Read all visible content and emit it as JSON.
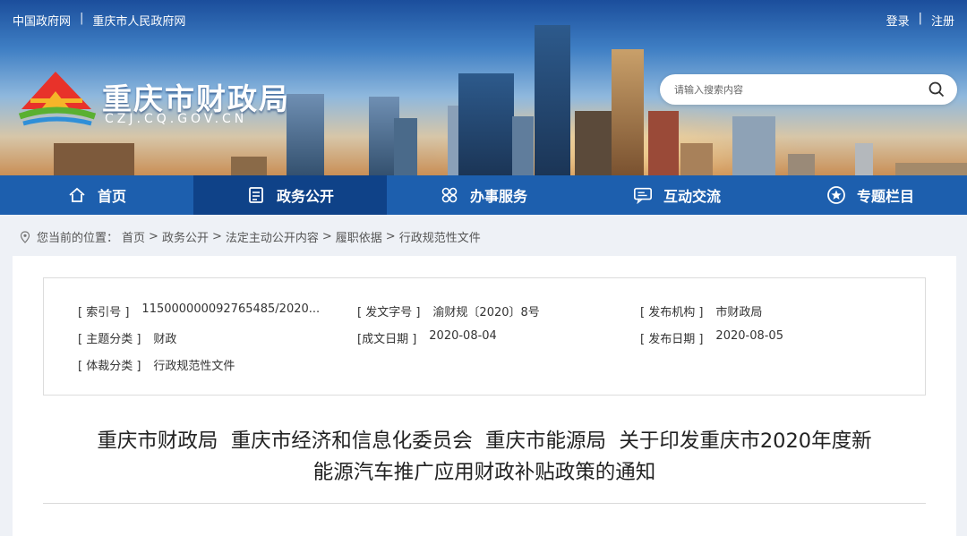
{
  "header": {
    "top_links": [
      "中国政府网",
      "重庆市人民政府网"
    ],
    "top_separator": "|",
    "auth_links": [
      "登录",
      "注册"
    ],
    "site_title": "重庆市财政局",
    "site_url": "CZJ.CQ.GOV.CN",
    "search_placeholder": "请输入搜索内容"
  },
  "nav": {
    "items": [
      {
        "label": "首页",
        "icon": "home-icon"
      },
      {
        "label": "政务公开",
        "icon": "document-icon",
        "active": true
      },
      {
        "label": "办事服务",
        "icon": "grid-icon"
      },
      {
        "label": "互动交流",
        "icon": "chat-icon"
      },
      {
        "label": "专题栏目",
        "icon": "star-icon"
      }
    ]
  },
  "breadcrumb": {
    "prefix": "您当前的位置：",
    "items": [
      "首页",
      "政务公开",
      "法定主动公开内容",
      "履职依据",
      "行政规范性文件"
    ],
    "separator": ">"
  },
  "meta": {
    "index_no": {
      "label": "[ 索引号 ]",
      "value": "115000000092765485/2020..."
    },
    "doc_no": {
      "label": "[ 发文字号 ]",
      "value": "渝财规〔2020〕8号"
    },
    "publisher": {
      "label": "[ 发布机构 ]",
      "value": "市财政局"
    },
    "topic": {
      "label": "[ 主题分类 ]",
      "value": "财政"
    },
    "written_date": {
      "label": "[成文日期 ]",
      "value": "2020-08-04"
    },
    "publish_date": {
      "label": "[ 发布日期 ]",
      "value": "2020-08-05"
    },
    "genre": {
      "label": "[ 体裁分类 ]",
      "value": "行政规范性文件"
    }
  },
  "document": {
    "title_line1": "重庆市财政局  重庆市经济和信息化委员会  重庆市能源局  关于印发重庆市2020年度新",
    "title_line2": "能源汽车推广应用财政补贴政策的通知"
  },
  "colors": {
    "nav_bg": "#1d5fae",
    "nav_active": "#0f4288",
    "page_bg": "#eef1f6"
  }
}
